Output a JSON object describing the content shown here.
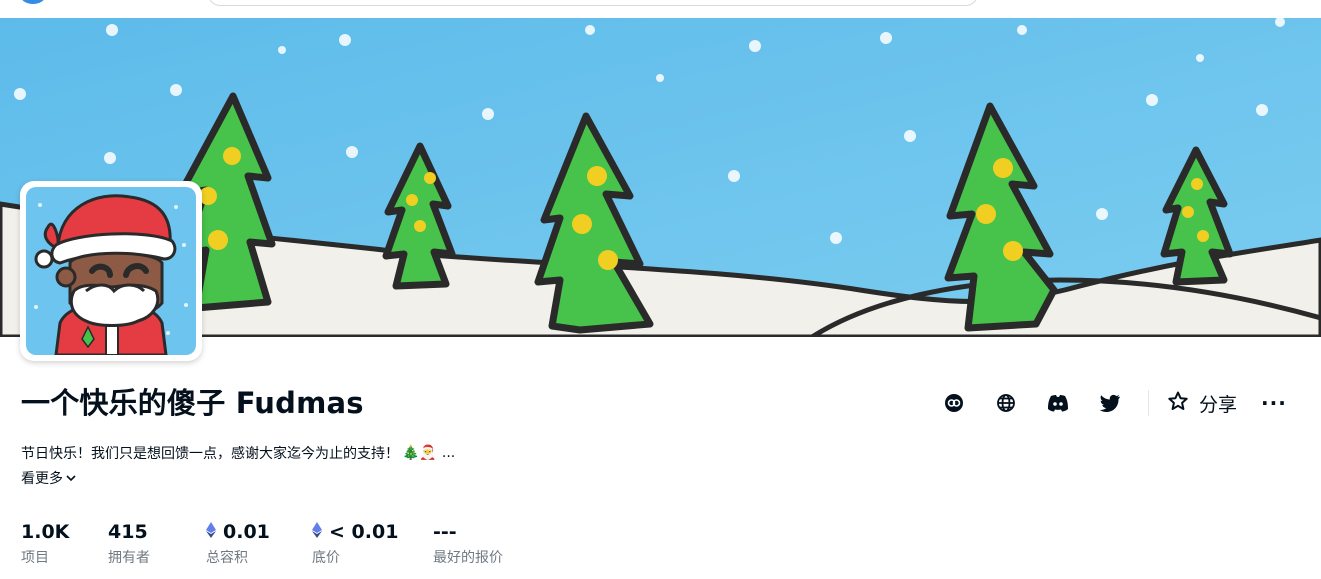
{
  "collection": {
    "title": "一个快乐的傻子 Fudmas",
    "description": "节日快乐！我们只是想回馈一点，感谢大家迄今为止的支持！",
    "description_emoji": "🎄🎅",
    "description_ellipsis": "...",
    "see_more_label": "看更多"
  },
  "actions": {
    "share_label": "分享",
    "more_label": "···",
    "icons": [
      "opensea-link-icon",
      "globe-icon",
      "discord-icon",
      "twitter-icon",
      "star-icon",
      "more-icon"
    ]
  },
  "stats": [
    {
      "value": "1.0K",
      "label": "项目",
      "eth": false
    },
    {
      "value": "415",
      "label": "拥有者",
      "eth": false
    },
    {
      "value": "0.01",
      "label": "总容积",
      "eth": true
    },
    {
      "value": "< 0.01",
      "label": "底价",
      "eth": true
    },
    {
      "value": "---",
      "label": "最好的报价",
      "eth": false
    }
  ],
  "colors": {
    "sky": "#6cc4ef",
    "tree": "#47c24a",
    "ornament": "#f0cf22",
    "snow": "#f2f0ea",
    "santa_red": "#e53c43",
    "skin": "#8d5a45",
    "text": "#04111d",
    "muted": "#707a83"
  }
}
